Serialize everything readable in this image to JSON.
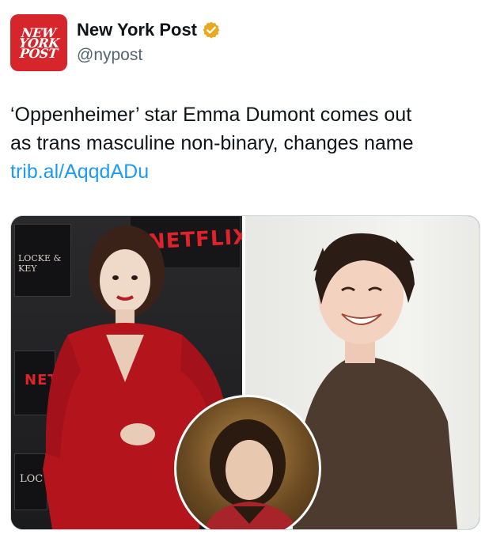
{
  "account": {
    "display_name": "New York Post",
    "handle": "@nypost",
    "verified_badge_icon": "verified-badge-icon",
    "avatar_logo_lines": [
      "NEW",
      "YORK",
      "POST"
    ],
    "badge_color": "#e8a820",
    "brand_color": "#d7262b"
  },
  "tweet": {
    "text_line1": "‘Oppenheimer’ star Emma Dumont comes out",
    "text_line2": "as trans masculine non-binary, changes name",
    "link": "trib.al/AqqdADu",
    "link_color": "#1d9bf0"
  },
  "media": {
    "left_photo": {
      "backdrop_logo": "NETFLIX",
      "backdrop_logo_partial": "NET",
      "show_logo": "LOCKE & KEY",
      "show_logo_partial": "LOC"
    },
    "right_photo": {},
    "inset_photo": {}
  }
}
